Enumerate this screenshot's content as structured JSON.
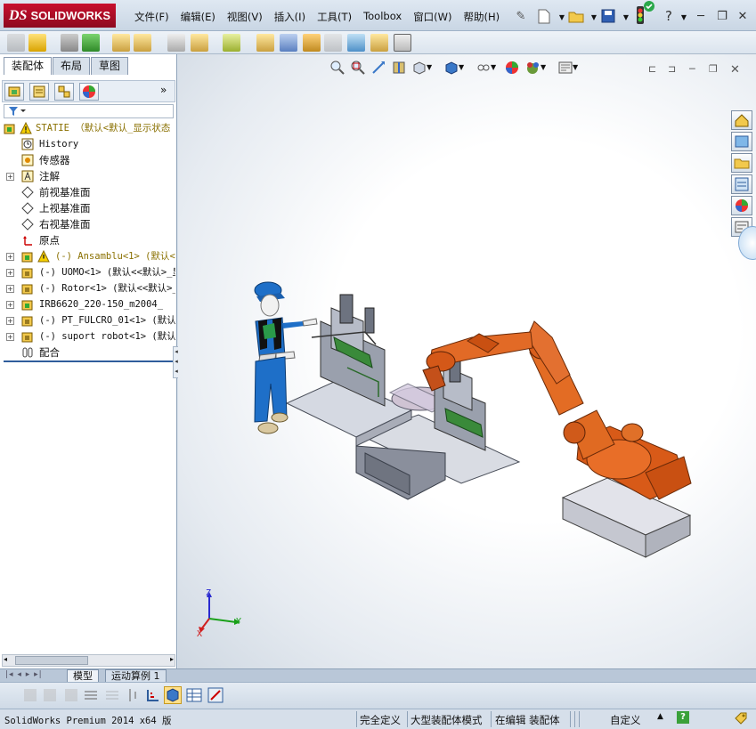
{
  "app": {
    "brand": "SOLIDWORKS",
    "brand_prefix": "DS"
  },
  "menu": [
    "文件(F)",
    "编辑(E)",
    "视图(V)",
    "插入(I)",
    "工具(T)",
    "Toolbox",
    "窗口(W)",
    "帮助(H)"
  ],
  "left_tabs": [
    "装配体",
    "布局",
    "草图"
  ],
  "tree": {
    "root": "STATIE （默认<默认_显示状态",
    "history": "History",
    "sensors": "传感器",
    "annotations": "注解",
    "front_plane": "前视基准面",
    "top_plane": "上视基准面",
    "right_plane": "右视基准面",
    "origin": "原点",
    "components": [
      "(-) Ansamblu<1> (默认<",
      "(-) UOMO<1> (默认<<默认>_显",
      "(-) Rotor<1> (默认<<默认>_",
      "IRB6620_220-150_m2004_",
      "(-) PT_FULCRO_01<1> (默认<",
      "(-) suport robot<1> (默认<"
    ],
    "mates": "配合"
  },
  "bottom_tabs": [
    "模型",
    "运动算例 1"
  ],
  "status": {
    "product": "SolidWorks Premium 2014 x64 版",
    "defined": "完全定义",
    "mode": "大型装配体模式",
    "editing": "在编辑 装配体",
    "custom": "自定义"
  },
  "triad": {
    "x": "X",
    "y": "Y",
    "z": "Z"
  },
  "colors": {
    "robot_orange": "#e0641e",
    "brand_red": "#c8102e",
    "worker_blue": "#1e6fc8"
  }
}
